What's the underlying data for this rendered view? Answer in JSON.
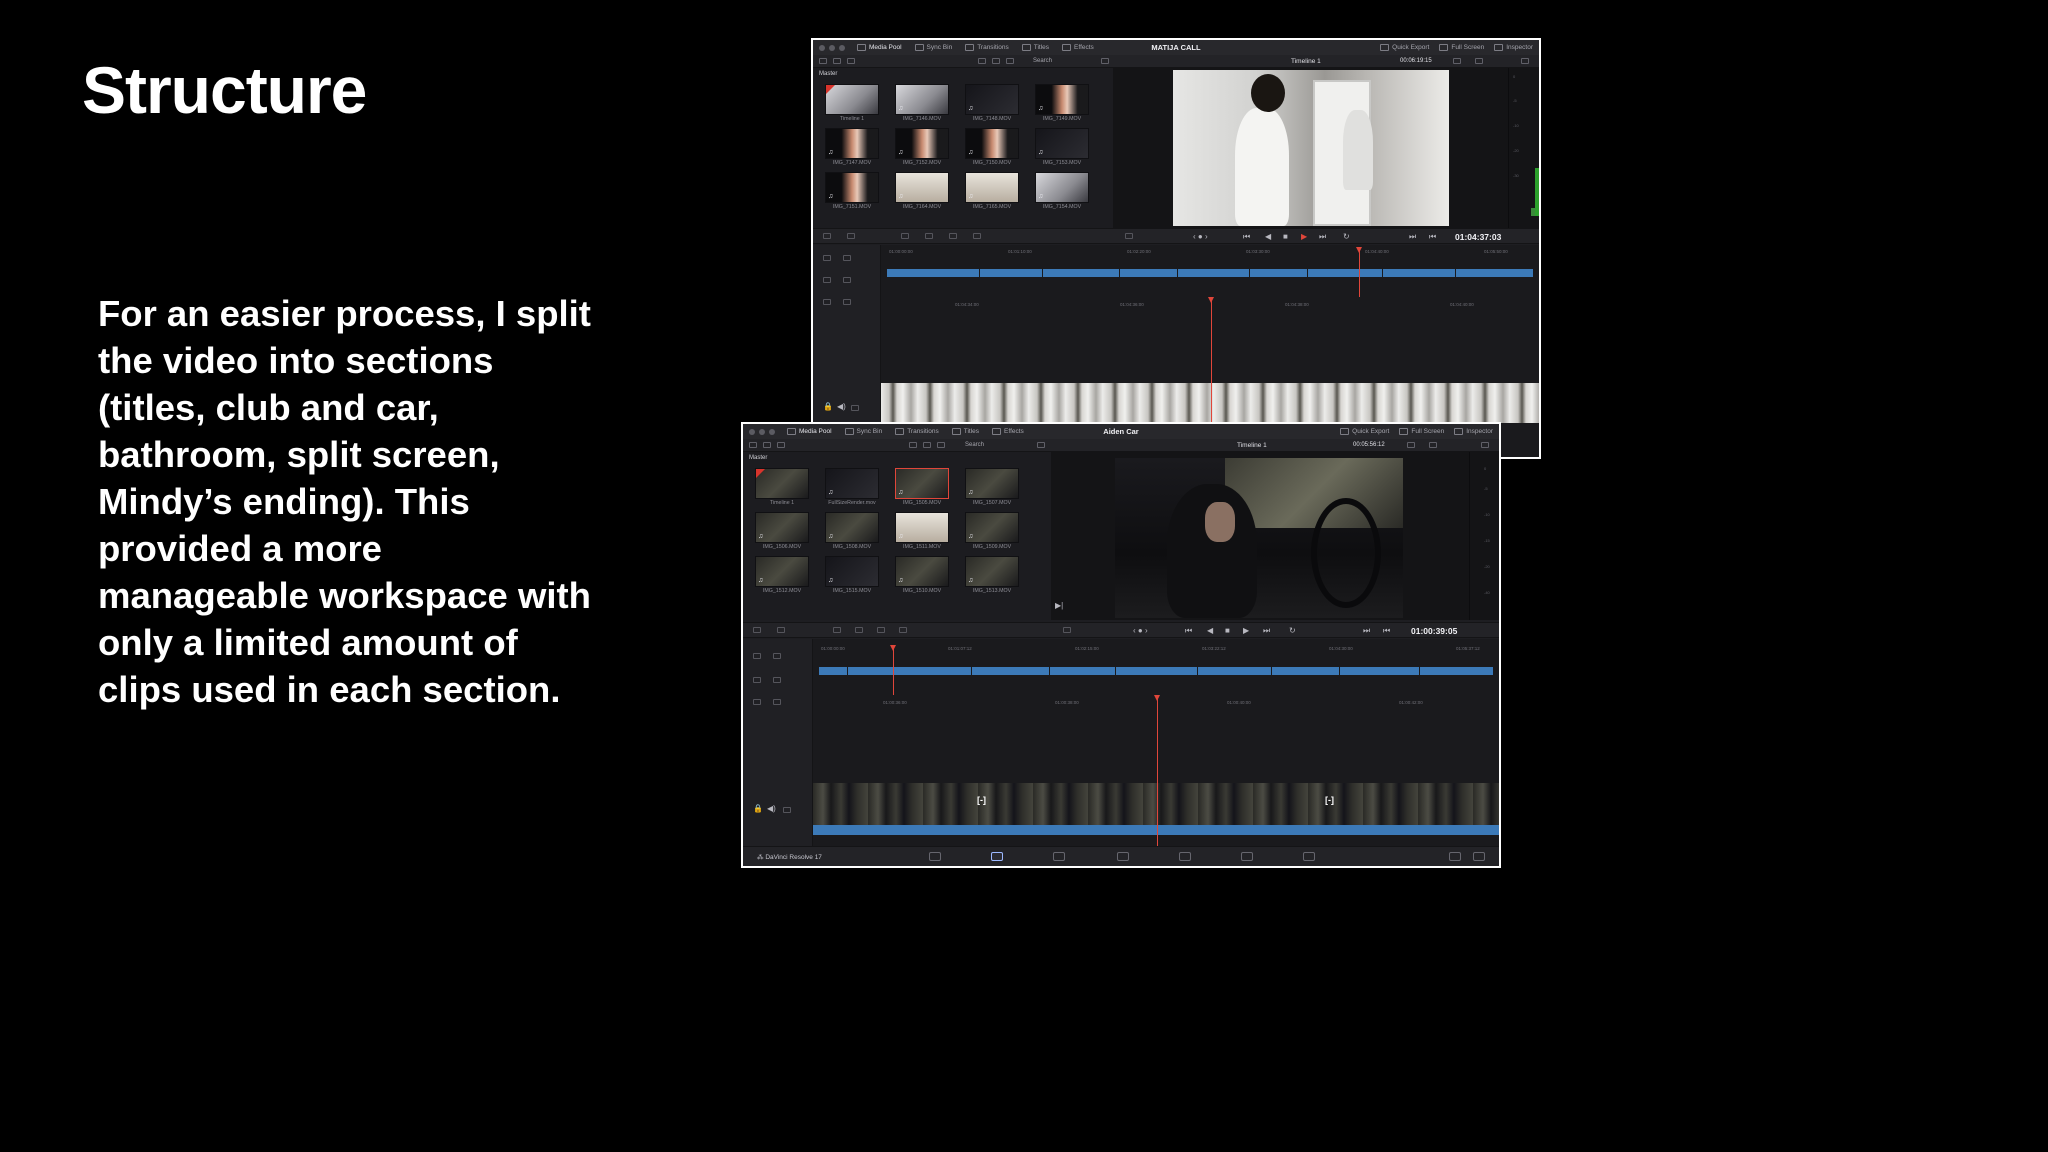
{
  "slide": {
    "title": "Structure",
    "body_lines": [
      "For an easier process, I split",
      "the video into sections",
      "(titles, club and car,",
      "bathroom, split screen,",
      "Mindy’s ending). This",
      "provided a more",
      "manageable workspace with",
      "only a limited amount of",
      "clips used in each section."
    ]
  },
  "resolve": {
    "toolbar": {
      "media_pool": "Media Pool",
      "sync_bin": "Sync Bin",
      "transitions": "Transitions",
      "titles": "Titles",
      "effects": "Effects",
      "quick_export": "Quick Export",
      "full_screen": "Full Screen",
      "inspector": "Inspector"
    },
    "search_label": "Search",
    "master_label": "Master",
    "brand": "DaVinci Resolve 17",
    "icons": [
      "media-pool-icon",
      "sync-bin-icon",
      "transitions-icon",
      "titles-icon",
      "effects-icon",
      "quick-export-icon",
      "full-screen-icon",
      "inspector-icon",
      "audio-speaker-icon",
      "play-icon",
      "stop-icon",
      "loop-icon",
      "skip-back-icon",
      "skip-forward-icon",
      "music-note-icon",
      "lock-icon",
      "speaker-icon",
      "davinci-logo-icon"
    ]
  },
  "window1": {
    "project": "MATIJA CALL",
    "timeline_name": "Timeline 1",
    "duration": "00:06:19:15",
    "timecode": "01:04:37:03",
    "clips": [
      {
        "name": "Timeline 1",
        "kind": "timeline",
        "style": "bright"
      },
      {
        "name": "IMG_7146.MOV",
        "kind": "video",
        "style": "bright"
      },
      {
        "name": "IMG_7148.MOV",
        "kind": "video",
        "style": "dark"
      },
      {
        "name": "IMG_7149.MOV",
        "kind": "video",
        "style": "skin"
      },
      {
        "name": "IMG_7147.MOV",
        "kind": "video",
        "style": "skin"
      },
      {
        "name": "IMG_7152.MOV",
        "kind": "video",
        "style": "skin"
      },
      {
        "name": "IMG_7150.MOV",
        "kind": "video",
        "style": "skin"
      },
      {
        "name": "IMG_7153.MOV",
        "kind": "video",
        "style": "dark"
      },
      {
        "name": "IMG_7151.MOV",
        "kind": "video",
        "style": "skin"
      },
      {
        "name": "IMG_7164.MOV",
        "kind": "video",
        "style": "light"
      },
      {
        "name": "IMG_7165.MOV",
        "kind": "video",
        "style": "light"
      },
      {
        "name": "IMG_7154.MOV",
        "kind": "video",
        "style": "bright"
      }
    ],
    "ruler_top": [
      "01:00:00:00",
      "01:01:10:00",
      "01:02:20:00",
      "01:03:30:00",
      "01:04:40:00",
      "01:05:50:00"
    ],
    "ruler_bottom": [
      "01:04:34:00",
      "01:04:36:00",
      "01:04:38:00",
      "01:04:40:00"
    ]
  },
  "window2": {
    "project": "Aiden Car",
    "timeline_name": "Timeline 1",
    "duration": "00:05:56:12",
    "timecode": "01:00:39:05",
    "clips": [
      {
        "name": "Timeline 1",
        "kind": "timeline",
        "style": "car"
      },
      {
        "name": "FullSizeRender.mov",
        "kind": "video",
        "style": "dark"
      },
      {
        "name": "IMG_1505.MOV",
        "kind": "video",
        "style": "car",
        "selected": true
      },
      {
        "name": "IMG_1507.MOV",
        "kind": "video",
        "style": "car"
      },
      {
        "name": "IMG_1506.MOV",
        "kind": "video",
        "style": "car"
      },
      {
        "name": "IMG_1508.MOV",
        "kind": "video",
        "style": "car"
      },
      {
        "name": "IMG_1511.MOV",
        "kind": "video",
        "style": "light"
      },
      {
        "name": "IMG_1509.MOV",
        "kind": "video",
        "style": "car"
      },
      {
        "name": "IMG_1512.MOV",
        "kind": "video",
        "style": "car"
      },
      {
        "name": "IMG_1515.MOV",
        "kind": "video",
        "style": "dark"
      },
      {
        "name": "IMG_1510.MOV",
        "kind": "video",
        "style": "car"
      },
      {
        "name": "IMG_1513.MOV",
        "kind": "video",
        "style": "car"
      }
    ],
    "ruler_top": [
      "01:00:00:00",
      "01:01:07:12",
      "01:02:15:00",
      "01:03:22:12",
      "01:04:30:00",
      "01:05:37:12"
    ],
    "ruler_bottom": [
      "01:00:36:00",
      "01:00:38:00",
      "01:00:40:00",
      "01:00:42:00"
    ],
    "gap_markers": [
      "[-]",
      "[-]"
    ]
  }
}
